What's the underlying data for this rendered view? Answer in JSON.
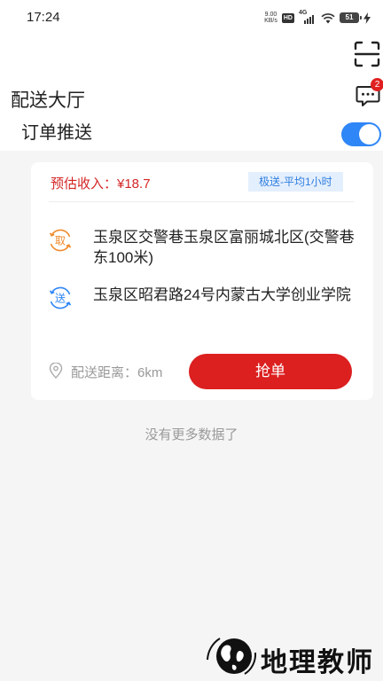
{
  "status_bar": {
    "time": "17:24",
    "net_speed_value": "9.00",
    "net_speed_unit": "KB/s",
    "hd": "HD",
    "network": "4G",
    "battery": "51"
  },
  "header": {
    "title": "配送大厅",
    "scan_icon": "scan-icon",
    "message_icon": "message-icon",
    "message_badge": "2"
  },
  "push": {
    "label": "订单推送",
    "enabled": true,
    "accent_color": "#2f86f6"
  },
  "orders": [
    {
      "income": "预估收入：¥18.7",
      "speed_tag": "极送-平均1小时",
      "pickup_icon_label": "取",
      "pickup_address": "玉泉区交警巷玉泉区富丽城北区(交警巷东100米)",
      "delivery_icon_label": "送",
      "delivery_address": "玉泉区昭君路24号内蒙古大学创业学院",
      "distance": "配送距离：6km",
      "grab_button": "抢单"
    }
  ],
  "list_footer": "没有更多数据了",
  "watermark": {
    "text": "地理教师"
  },
  "colors": {
    "income": "#d42626",
    "grab_button": "#dc1f1f",
    "pickup_icon": "#f08a2c",
    "delivery_icon": "#2f86f6"
  }
}
